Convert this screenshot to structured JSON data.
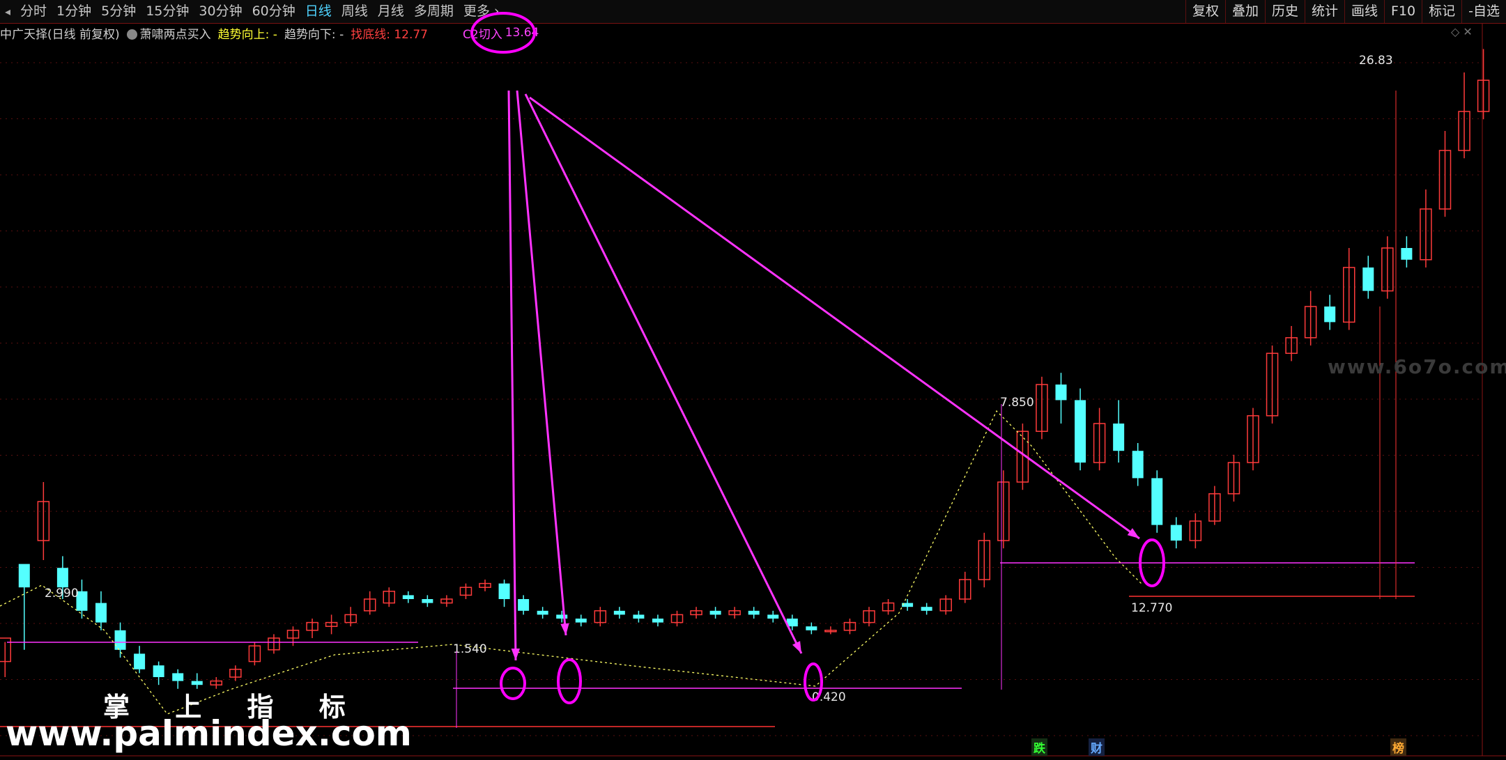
{
  "toolbar": {
    "tabs": [
      "分时",
      "1分钟",
      "5分钟",
      "15分钟",
      "30分钟",
      "60分钟",
      "日线",
      "周线",
      "月线",
      "多周期",
      "更多"
    ],
    "active_tab": "日线",
    "right_tools": [
      "复权",
      "叠加",
      "历史",
      "统计",
      "画线",
      "F10",
      "标记",
      "-自选"
    ]
  },
  "infobar": {
    "stock": "中广天择(日线 前复权)",
    "indicator": "萧啸两点买入",
    "trend_up_label": "趋势向上: -",
    "trend_down_label": "趋势向下: -",
    "bottom_label": "找底线: 12.77",
    "c2_label": "C2切入",
    "c2_value": "13.64"
  },
  "labels": {
    "high_1": "2.990",
    "level_1": "1.540",
    "low_1": "0.420",
    "peak_1": "7.850",
    "low_2": "12.770",
    "peak_2": "26.83"
  },
  "watermarks": {
    "cn": "掌 上 指 标",
    "url": "www.palmindex.com",
    "site": "www.6o7o.com"
  },
  "markers": [
    "跌",
    "财",
    "榜"
  ],
  "colors": {
    "up": "#ff3b3b",
    "down": "#54ffff",
    "arrow": "#ff33ff",
    "accent": "#ff00ff"
  },
  "candles": [
    [
      5,
      9,
      15,
      5,
      14
    ],
    [
      24,
      34,
      28,
      12,
      33
    ],
    [
      43,
      40,
      50,
      35,
      55
    ],
    [
      62,
      33,
      28,
      25,
      36
    ],
    [
      81,
      27,
      22,
      20,
      30
    ],
    [
      100,
      24,
      19,
      17,
      27
    ],
    [
      119,
      17,
      12,
      10,
      19
    ],
    [
      138,
      11,
      7,
      6,
      13
    ],
    [
      157,
      8,
      5,
      3,
      9
    ],
    [
      176,
      6,
      4,
      2,
      7
    ],
    [
      195,
      4,
      3,
      2,
      6
    ],
    [
      214,
      3,
      4,
      2,
      5
    ],
    [
      233,
      5,
      7,
      4,
      8
    ],
    [
      252,
      9,
      13,
      8,
      14
    ],
    [
      271,
      12,
      15,
      11,
      16
    ],
    [
      290,
      15,
      17,
      13,
      18
    ],
    [
      309,
      17,
      19,
      15,
      20
    ],
    [
      328,
      18,
      19,
      16,
      21
    ],
    [
      347,
      19,
      21,
      18,
      23
    ],
    [
      366,
      22,
      25,
      21,
      27
    ],
    [
      385,
      24,
      27,
      23,
      28
    ],
    [
      404,
      26,
      25,
      24,
      27
    ],
    [
      423,
      25,
      24,
      23,
      26
    ],
    [
      442,
      24,
      25,
      23,
      26
    ],
    [
      461,
      26,
      28,
      25,
      29
    ],
    [
      480,
      28,
      29,
      27,
      30
    ],
    [
      499,
      29,
      25,
      23,
      30
    ],
    [
      518,
      25,
      22,
      21,
      26
    ],
    [
      537,
      22,
      21,
      20,
      23
    ],
    [
      556,
      21,
      20,
      19,
      22
    ],
    [
      575,
      20,
      19,
      18,
      21
    ],
    [
      594,
      19,
      22,
      18,
      23
    ],
    [
      613,
      22,
      21,
      20,
      23
    ],
    [
      632,
      21,
      20,
      19,
      22
    ],
    [
      651,
      20,
      19,
      18,
      21
    ],
    [
      670,
      19,
      21,
      18,
      22
    ],
    [
      689,
      21,
      22,
      20,
      23
    ],
    [
      708,
      22,
      21,
      20,
      23
    ],
    [
      727,
      21,
      22,
      20,
      23
    ],
    [
      746,
      22,
      21,
      20,
      23
    ],
    [
      765,
      21,
      20,
      19,
      22
    ],
    [
      784,
      20,
      18,
      17,
      21
    ],
    [
      803,
      18,
      17,
      16,
      19
    ],
    [
      822,
      17,
      17,
      16,
      18
    ],
    [
      841,
      17,
      19,
      16,
      20
    ],
    [
      860,
      19,
      22,
      18,
      23
    ],
    [
      879,
      22,
      24,
      21,
      25
    ],
    [
      898,
      24,
      23,
      22,
      25
    ],
    [
      917,
      23,
      22,
      21,
      24
    ],
    [
      936,
      22,
      25,
      21,
      26
    ],
    [
      955,
      25,
      30,
      24,
      32
    ],
    [
      974,
      30,
      40,
      28,
      42
    ],
    [
      993,
      40,
      55,
      38,
      58
    ],
    [
      1012,
      55,
      68,
      53,
      70
    ],
    [
      1031,
      68,
      80,
      66,
      82
    ],
    [
      1050,
      80,
      76,
      70,
      83
    ],
    [
      1069,
      76,
      60,
      58,
      79
    ],
    [
      1088,
      60,
      70,
      58,
      74
    ],
    [
      1107,
      70,
      63,
      60,
      76
    ],
    [
      1126,
      63,
      56,
      54,
      65
    ],
    [
      1145,
      56,
      44,
      42,
      58
    ],
    [
      1164,
      44,
      40,
      38,
      46
    ],
    [
      1183,
      40,
      45,
      38,
      47
    ],
    [
      1202,
      45,
      52,
      44,
      54
    ],
    [
      1221,
      52,
      60,
      50,
      62
    ],
    [
      1240,
      60,
      72,
      58,
      74
    ],
    [
      1259,
      72,
      88,
      70,
      90
    ],
    [
      1278,
      88,
      92,
      86,
      95
    ],
    [
      1297,
      92,
      100,
      90,
      104
    ],
    [
      1316,
      100,
      96,
      94,
      103
    ],
    [
      1335,
      96,
      110,
      94,
      115
    ],
    [
      1354,
      110,
      104,
      102,
      113
    ],
    [
      1373,
      104,
      115,
      102,
      118
    ],
    [
      1392,
      115,
      112,
      110,
      118
    ],
    [
      1411,
      112,
      125,
      110,
      130
    ],
    [
      1430,
      125,
      140,
      123,
      145
    ],
    [
      1449,
      140,
      150,
      138,
      160
    ],
    [
      1468,
      150,
      158,
      148,
      166
    ]
  ]
}
